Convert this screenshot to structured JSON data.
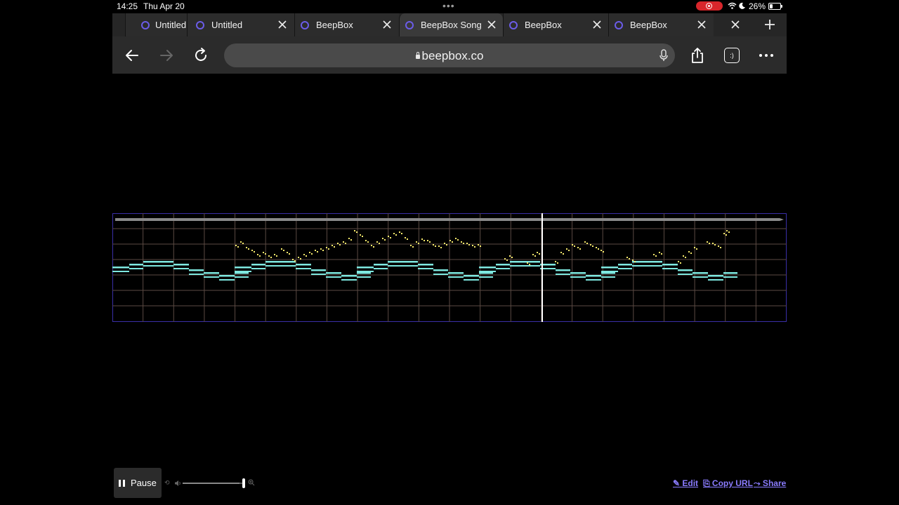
{
  "status_bar": {
    "time": "14:25",
    "date": "Thu Apr 20",
    "battery": "26%",
    "battery_level": 0.26,
    "record_color": "#d8262b"
  },
  "tabs": [
    {
      "title": "Untitled",
      "active": false,
      "close_visible": false
    },
    {
      "title": "Untitled",
      "active": false,
      "close_visible": true
    },
    {
      "title": "BeepBox",
      "active": false,
      "close_visible": true
    },
    {
      "title": "BeepBox Song",
      "active": true,
      "close_visible": true
    },
    {
      "title": "BeepBox",
      "active": false,
      "close_visible": true
    },
    {
      "title": "BeepBox",
      "active": false,
      "close_visible": true
    }
  ],
  "toolbar": {
    "url": "beepbox.co",
    "extension_label": ":)",
    "icons": [
      "back-icon",
      "forward-icon",
      "reload-icon",
      "lock-icon",
      "microphone-icon",
      "share-icon",
      "extension-icon",
      "more-icon"
    ]
  },
  "player": {
    "playhead_fraction": 0.636,
    "bars": 22,
    "colors": {
      "grid": "#5b4a43",
      "lead_notes": "#f5e86b",
      "bass_notes": "#7ee8e0",
      "playhead": "#ffffff",
      "border": "#3a2fa8"
    }
  },
  "controls": {
    "pause_label": "Pause",
    "volume": 0.92,
    "links": {
      "edit": "✎ Edit",
      "copy_url": "⎘ Copy URL",
      "share": "⤳ Share"
    }
  }
}
